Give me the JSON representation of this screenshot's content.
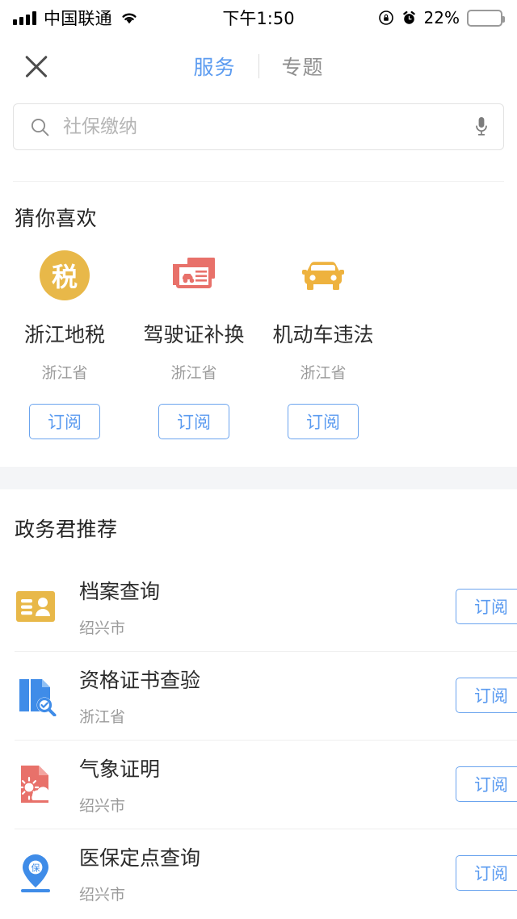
{
  "status_bar": {
    "carrier": "中国联通",
    "time": "下午1:50",
    "battery_percent": "22%",
    "battery_level": 22,
    "icons": [
      "signal-bars-icon",
      "wifi-icon",
      "rotation-lock-icon",
      "alarm-clock-icon",
      "battery-icon"
    ]
  },
  "nav": {
    "close_label": "",
    "tabs": [
      {
        "label": "服务",
        "active": true
      },
      {
        "label": "专题",
        "active": false
      }
    ]
  },
  "search": {
    "placeholder": "社保缴纳",
    "value": ""
  },
  "guess": {
    "title": "猜你喜欢",
    "items": [
      {
        "name": "浙江地税",
        "region": "浙江省",
        "subscribe": "订阅",
        "icon": "tax-badge-icon",
        "icon_text": "税",
        "color": "#e8b849"
      },
      {
        "name": "驾驶证补换",
        "region": "浙江省",
        "subscribe": "订阅",
        "icon": "driver-license-icon",
        "icon_text": "",
        "color": "#e8716a"
      },
      {
        "name": "机动车违法",
        "region": "浙江省",
        "subscribe": "订阅",
        "icon": "car-front-icon",
        "icon_text": "",
        "color": "#eeb23e"
      }
    ]
  },
  "recommend": {
    "title": "政务君推荐",
    "items": [
      {
        "name": "档案查询",
        "region": "绍兴市",
        "subscribe": "订阅",
        "icon": "id-card-person-icon",
        "color": "#e8b849"
      },
      {
        "name": "资格证书查验",
        "region": "浙江省",
        "subscribe": "订阅",
        "icon": "document-search-icon",
        "color": "#3f8ce8"
      },
      {
        "name": "气象证明",
        "region": "绍兴市",
        "subscribe": "订阅",
        "icon": "weather-document-icon",
        "color": "#e8716a"
      },
      {
        "name": "医保定点查询",
        "region": "绍兴市",
        "subscribe": "订阅",
        "icon": "map-pin-insurance-icon",
        "color": "#3f8ce8"
      }
    ]
  },
  "colors": {
    "accent_blue": "#5b9bf0",
    "text_primary": "#2b2b2b",
    "text_secondary": "#9b9b9b",
    "band": "#f4f5f7"
  }
}
